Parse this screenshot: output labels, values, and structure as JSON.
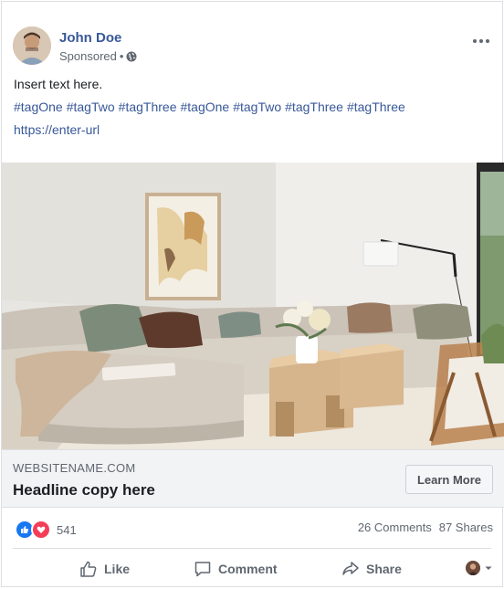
{
  "post": {
    "author": "John Doe",
    "meta_label": "Sponsored",
    "meta_sep": "•",
    "text": "Insert text here.",
    "hashtags": [
      "#tagOne",
      "#tagTwo",
      "#tagThree",
      "#tagOne",
      "#tagTwo",
      "#tagThree",
      "#tagThree"
    ],
    "url": "https://enter-url"
  },
  "link_preview": {
    "site": "WEBSITENAME.COM",
    "headline": "Headline copy here",
    "cta": "Learn More"
  },
  "stats": {
    "reaction_count": "541",
    "comments": "26 Comments",
    "shares": "87 Shares"
  },
  "actions": {
    "like": "Like",
    "comment": "Comment",
    "share": "Share"
  },
  "colors": {
    "link": "#385898",
    "like_blue": "#1877f2",
    "love_red": "#f33e58",
    "muted": "#606770",
    "preview_bg": "#f2f3f5"
  },
  "icons": [
    "globe-icon",
    "more-options-icon",
    "like-reaction-icon",
    "love-reaction-icon",
    "thumbs-up-icon",
    "comment-icon",
    "share-icon",
    "chevron-down-icon"
  ]
}
